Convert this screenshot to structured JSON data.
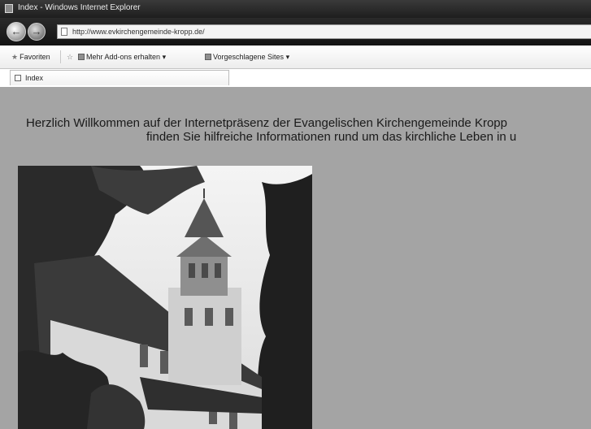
{
  "window": {
    "title": "Index - Windows Internet Explorer"
  },
  "address_bar": {
    "url": "http://www.evkirchengemeinde-kropp.de/"
  },
  "toolbar": {
    "favorites_label": "Favoriten",
    "more_addons_label": "Mehr Add-ons erhalten",
    "suggested_sites_label": "Vorgeschlagene Sites"
  },
  "tabs": [
    {
      "label": "Index"
    }
  ],
  "page": {
    "welcome_line1": "Herzlich Willkommen auf der Internetpräsenz der Evangelischen Kirchengemeinde Kropp",
    "welcome_line2": "finden Sie hilfreiche Informationen rund um das kirchliche Leben in u"
  },
  "colors": {
    "content_background": "#a4a4a4",
    "chrome_dark": "#1e1e1e"
  }
}
